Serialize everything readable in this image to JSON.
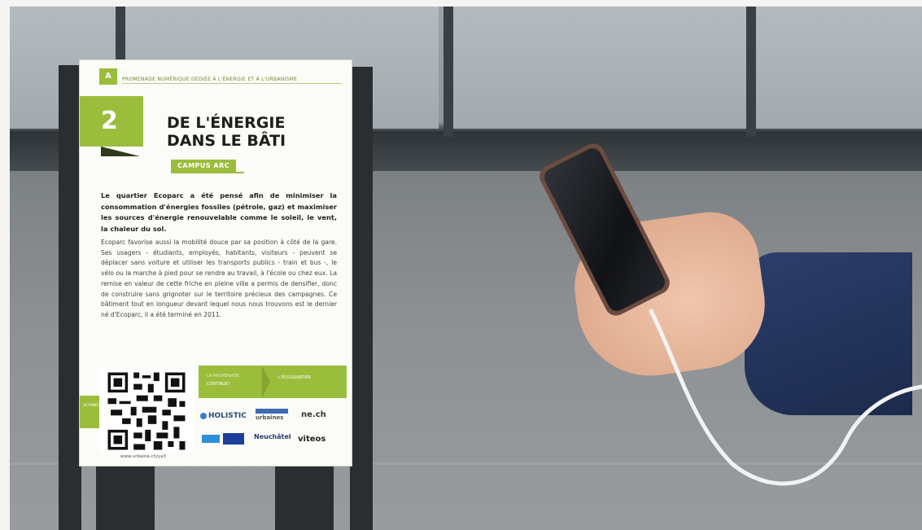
{
  "sign": {
    "tag_letter": "A",
    "route_title": "PROMENADE NUMÉRIQUE DÉDIÉE À L'ÉNERGIE ET À L'URBANISME",
    "number": "2",
    "headline_line1": "DE L'ÉNERGIE",
    "headline_line2": "DANS LE BÂTI",
    "badge": "CAMPUS ARC",
    "lead": "Le quartier Ecoparc a été pensé afin de minimiser la consommation d'énergies fossiles (pétrole, gaz) et maximiser les sources d'énergie renouvelable comme le soleil, le vent, la chaleur du sol.",
    "body": "Ecoparc favorise aussi la mobilité douce par sa position à côté de la gare. Ses usagers - étudiants, employés, habitants, visiteurs - peuvent se déplacer sans voiture et utiliser les transports publics - train et bus -, le vélo ou la marche à pied pour se rendre au travail, à l'école ou chez eux. La remise en valeur de cette friche en pleine ville a permis de densifier, donc de construire sans grignoter sur le territoire précieux des campagnes. Ce bâtiment tout en longueur devant lequel nous nous trouvons est le dernier né d'Ecoparc, il a été terminé en 2011.",
    "continue_small": "LA PROMENADE",
    "continue_label": "CONTINUE!",
    "next_stop": "L'ÉCOQUARTIER",
    "green_block_text": "SCANNEZ LE CODE",
    "qr_url": "www.urbaine.ch/ya3",
    "logos": {
      "holistic": "HOLISTIC",
      "urban": "urbaines",
      "ne": "ne.ch",
      "neuchatel": "Neuchâtel",
      "viteos": "viteos"
    }
  },
  "colors": {
    "accent_green": "#9bbd3c",
    "sleeve_navy": "#1c2a4c"
  }
}
